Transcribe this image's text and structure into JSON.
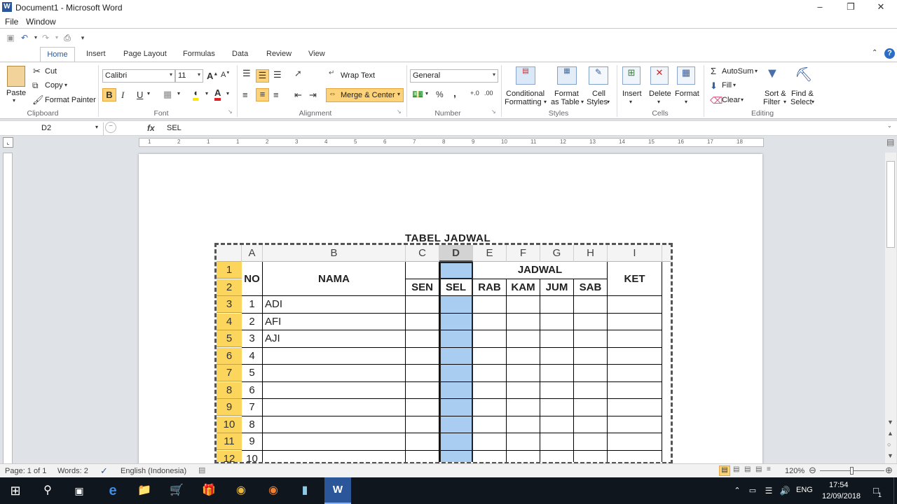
{
  "window": {
    "title": "Document1 - Microsoft Word",
    "app_letter": "W"
  },
  "menu": [
    "File",
    "Window"
  ],
  "tabs": [
    "Home",
    "Insert",
    "Page Layout",
    "Formulas",
    "Data",
    "Review",
    "View"
  ],
  "clipboard": {
    "paste": "Paste",
    "cut": "Cut",
    "copy": "Copy",
    "format_painter": "Format Painter",
    "label": "Clipboard"
  },
  "font": {
    "name": "Calibri",
    "size": "11",
    "bold": "B",
    "italic": "I",
    "underline": "U",
    "label": "Font"
  },
  "alignment": {
    "wrap_text": "Wrap Text",
    "merge_center": "Merge & Center",
    "label": "Alignment"
  },
  "number": {
    "format": "General",
    "percent": "%",
    "comma": ",",
    "label": "Number"
  },
  "styles": {
    "conditional": [
      "Conditional",
      "Formatting"
    ],
    "format_table": [
      "Format",
      "as Table"
    ],
    "cell_styles": [
      "Cell",
      "Styles"
    ],
    "label": "Styles"
  },
  "cells": {
    "insert": "Insert",
    "delete": "Delete",
    "format": "Format",
    "label": "Cells"
  },
  "editing": {
    "autosum": "AutoSum",
    "fill": "Fill",
    "clear": "Clear",
    "sort": [
      "Sort &",
      "Filter"
    ],
    "find": [
      "Find &",
      "Select"
    ],
    "label": "Editing"
  },
  "formula_bar": {
    "name_box": "D2",
    "fx": "fx",
    "value": "SEL"
  },
  "ruler_numbers": [
    "1",
    "2",
    "1",
    "1",
    "2",
    "3",
    "4",
    "5",
    "6",
    "7",
    "8",
    "9",
    "10",
    "11",
    "12",
    "13",
    "14",
    "15",
    "16",
    "17",
    "18"
  ],
  "sheet": {
    "title": "TABEL JADWAL",
    "columns": [
      "A",
      "B",
      "C",
      "D",
      "E",
      "F",
      "G",
      "H",
      "I"
    ],
    "row_numbers": [
      "1",
      "2",
      "3",
      "4",
      "5",
      "6",
      "7",
      "8",
      "9",
      "10",
      "11",
      "12"
    ],
    "headers": {
      "no": "NO",
      "nama": "NAMA",
      "jadwal": "JADWAL",
      "ket": "KET",
      "days": [
        "SEN",
        "SEL",
        "RAB",
        "KAM",
        "JUM",
        "SAB"
      ]
    },
    "rows": [
      {
        "no": "1",
        "nama": "ADI"
      },
      {
        "no": "2",
        "nama": "AFI"
      },
      {
        "no": "3",
        "nama": "AJI"
      },
      {
        "no": "4",
        "nama": ""
      },
      {
        "no": "5",
        "nama": ""
      },
      {
        "no": "6",
        "nama": ""
      },
      {
        "no": "7",
        "nama": ""
      },
      {
        "no": "8",
        "nama": ""
      },
      {
        "no": "9",
        "nama": ""
      },
      {
        "no": "10",
        "nama": ""
      }
    ],
    "selected_column": "D"
  },
  "status": {
    "page": "Page: 1 of 1",
    "words": "Words: 2",
    "language": "English (Indonesia)",
    "zoom": "120%"
  },
  "tray": {
    "lang": "ENG",
    "time": "17:54",
    "date": "12/09/2018",
    "notif": "1"
  },
  "colors": {
    "accent": "#2b579a",
    "row_header": "#fbd55c",
    "selection": "#a9cdf0",
    "highlight": "#fcd27a"
  }
}
